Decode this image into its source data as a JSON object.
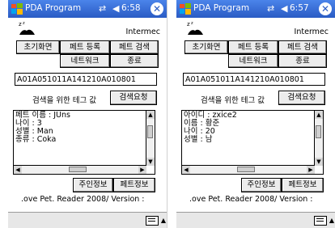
{
  "screens": [
    {
      "title": "PDA Program",
      "clock": "6:58",
      "brand": "Intermec",
      "buttons": {
        "init": "초기화면",
        "pet_register": "페트 등록",
        "pet_search": "페트 검색",
        "network": "네트워크",
        "exit": "종료"
      },
      "tag_value": "A01A051011A141210A010801",
      "search_label": "검색을 위한 테그 값",
      "search_button": "검색요청",
      "info_lines": [
        "페트 이름 : JUns",
        "나이 : 3",
        "성별 : Man",
        "종류 : Coka"
      ],
      "owner_button": "주인정보",
      "pet_button": "페트정보",
      "footer": ".ove Pet. Reader 2008/ Version :"
    },
    {
      "title": "PDA Program",
      "clock": "6:57",
      "brand": "Intermec",
      "buttons": {
        "init": "초기화면",
        "pet_register": "페트 등록",
        "pet_search": "페트 검색",
        "network": "네트워크",
        "exit": "종료"
      },
      "tag_value": "A01A051011A141210A010801",
      "search_label": "검색을 위한 테그 값",
      "search_button": "검색요청",
      "info_lines": [
        "아이디 : zxice2",
        "이름 : 황준",
        "나이 : 20",
        "성별 : 남"
      ],
      "owner_button": "주인정보",
      "pet_button": "페트정보",
      "footer": ".ove Pet. Reader 2008/ Version :"
    }
  ],
  "colors": {
    "titlebar": "#2a5bc4",
    "background": "#ffffff"
  },
  "icons": {
    "start": "windows-flag-icon",
    "signal": "signal-icon",
    "volume": "volume-icon",
    "close": "close-icon",
    "keyboard": "keyboard-icon"
  }
}
